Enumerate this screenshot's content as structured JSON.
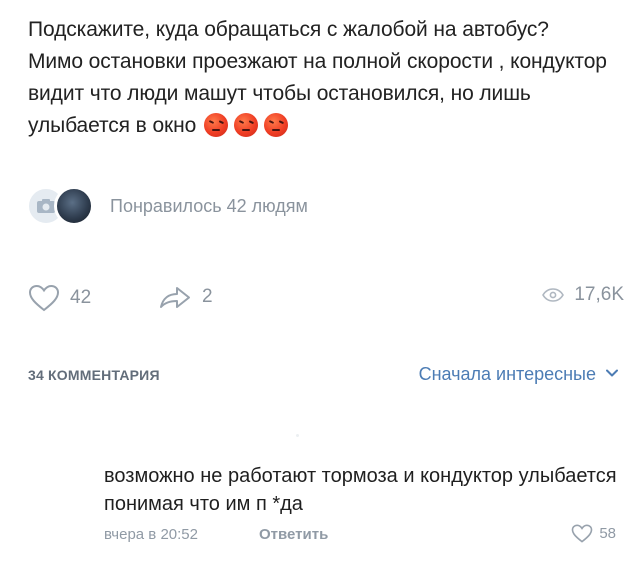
{
  "post": {
    "text": "Подскажите, куда обращаться с жалобой на автобус? Мимо остановки проезжают на полной скорости , кондуктор видит что люди машут чтобы остановился, но лишь улыбается в окно",
    "emojis": [
      "angry-face-emoji",
      "angry-face-emoji",
      "angry-face-emoji"
    ]
  },
  "likes_summary": {
    "text": "Понравилось 42 людям"
  },
  "actions": {
    "likes": "42",
    "shares": "2",
    "views": "17,6K"
  },
  "comments": {
    "count_label": "34 КОММЕНТАРИЯ",
    "sort_label": "Сначала интересные",
    "items": [
      {
        "text": "возможно не работают тормоза и кондуктор улыбается понимая что им п *да",
        "time": "вчера в 20:52",
        "reply_label": "Ответить",
        "likes": "58"
      }
    ]
  },
  "colors": {
    "accent": "#4c7cb4",
    "muted": "#8a939d",
    "text": "#222222",
    "emoji": "#ef3d24"
  }
}
